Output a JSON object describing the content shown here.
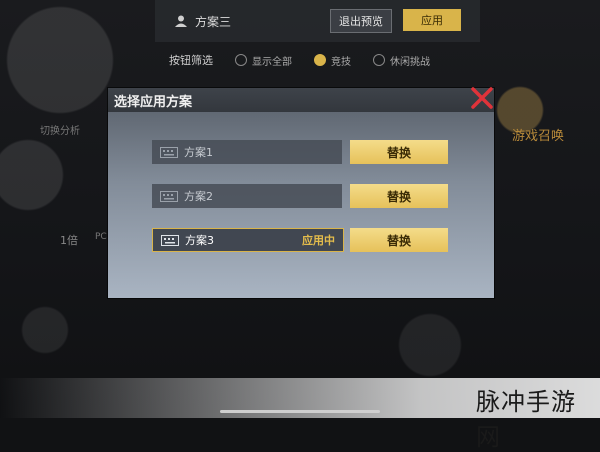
{
  "toolbar": {
    "scheme_name": "方案三",
    "exit_preview_label": "退出预览",
    "apply_label": "应用"
  },
  "filter": {
    "label": "按钮筛选",
    "options": [
      {
        "label": "显示全部",
        "selected": false
      },
      {
        "label": "竞技",
        "selected": true
      },
      {
        "label": "休闲挑战",
        "selected": false
      }
    ]
  },
  "background_labels": {
    "left_top": "切换分析",
    "right_top": "游戏召唤",
    "left_mid": "1倍",
    "pc": "PC"
  },
  "modal": {
    "title": "选择应用方案",
    "schemes": [
      {
        "name": "方案1",
        "status": "",
        "button": "替换",
        "active": false
      },
      {
        "name": "方案2",
        "status": "",
        "button": "替换",
        "active": false
      },
      {
        "name": "方案3",
        "status": "应用中",
        "button": "替换",
        "active": true
      }
    ]
  },
  "colors": {
    "accent_gold": "#d9b44a",
    "close_red": "#e0333a"
  },
  "watermark": "脉冲手游网"
}
